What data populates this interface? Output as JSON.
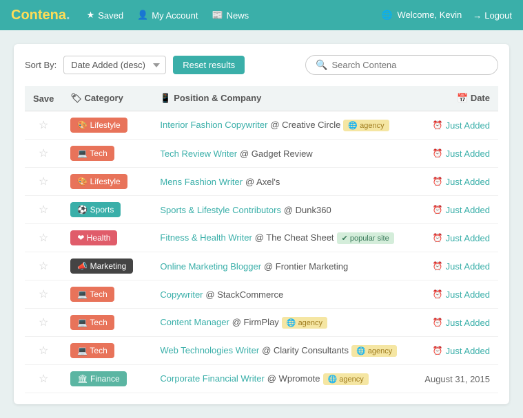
{
  "brand": {
    "name": "Contena",
    "dot": "."
  },
  "nav": {
    "saved": "Saved",
    "account": "My Account",
    "news": "News",
    "welcome": "Welcome, Kevin",
    "logout": "Logout"
  },
  "controls": {
    "sort_label": "Sort By:",
    "sort_value": "Date Added (desc)",
    "reset_label": "Reset results",
    "search_placeholder": "Search Contena"
  },
  "table": {
    "headers": {
      "save": "Save",
      "category": "Category",
      "position": "Position & Company",
      "date": "Date"
    },
    "rows": [
      {
        "category": "Lifestyle",
        "category_type": "lifestyle",
        "position": "Interior Fashion Copywriter",
        "company": "Creative Circle",
        "tag": "agency",
        "date": "Just Added"
      },
      {
        "category": "Tech",
        "category_type": "tech",
        "position": "Tech Review Writer",
        "company": "Gadget Review",
        "tag": "",
        "date": "Just Added"
      },
      {
        "category": "Lifestyle",
        "category_type": "lifestyle",
        "position": "Mens Fashion Writer",
        "company": "Axel's",
        "tag": "",
        "date": "Just Added"
      },
      {
        "category": "Sports",
        "category_type": "sports",
        "position": "Sports & Lifestyle Contributors",
        "company": "Dunk360",
        "tag": "",
        "date": "Just Added"
      },
      {
        "category": "Health",
        "category_type": "health",
        "position": "Fitness & Health Writer",
        "company": "The Cheat Sheet",
        "tag": "popular",
        "date": "Just Added"
      },
      {
        "category": "Marketing",
        "category_type": "marketing",
        "position": "Online Marketing Blogger",
        "company": "Frontier Marketing",
        "tag": "",
        "date": "Just Added"
      },
      {
        "category": "Tech",
        "category_type": "tech",
        "position": "Copywriter",
        "company": "StackCommerce",
        "tag": "",
        "date": "Just Added"
      },
      {
        "category": "Tech",
        "category_type": "tech",
        "position": "Content Manager",
        "company": "FirmPlay",
        "tag": "agency",
        "date": "Just Added"
      },
      {
        "category": "Tech",
        "category_type": "tech",
        "position": "Web Technologies Writer",
        "company": "Clarity Consultants",
        "tag": "agency",
        "date": "Just Added"
      },
      {
        "category": "Finance",
        "category_type": "finance",
        "position": "Corporate Financial Writer",
        "company": "Wpromote",
        "tag": "agency",
        "date": "August 31, 2015"
      }
    ]
  }
}
